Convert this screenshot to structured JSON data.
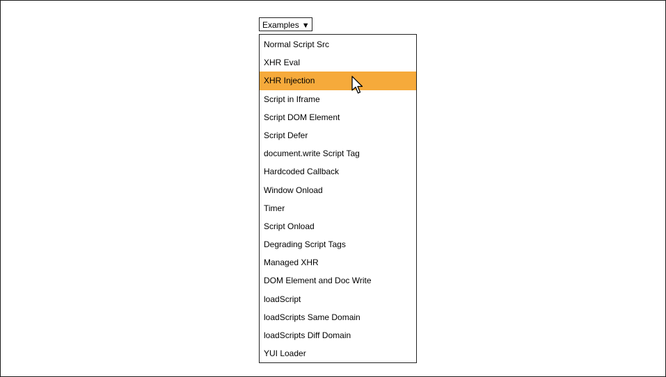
{
  "dropdown": {
    "label": "Examples",
    "caret": "▼"
  },
  "menu": {
    "items": [
      {
        "label": "Normal Script Src"
      },
      {
        "label": "XHR Eval"
      },
      {
        "label": "XHR Injection",
        "highlighted": true
      },
      {
        "label": "Script in Iframe"
      },
      {
        "label": "Script DOM Element"
      },
      {
        "label": "Script Defer"
      },
      {
        "label": "document.write Script Tag"
      },
      {
        "label": "Hardcoded Callback"
      },
      {
        "label": "Window Onload"
      },
      {
        "label": "Timer"
      },
      {
        "label": "Script Onload"
      },
      {
        "label": "Degrading Script Tags"
      },
      {
        "label": "Managed XHR"
      },
      {
        "label": "DOM Element and Doc Write"
      },
      {
        "label": "loadScript"
      },
      {
        "label": "loadScripts Same Domain"
      },
      {
        "label": "loadScripts Diff Domain"
      },
      {
        "label": "YUI Loader"
      }
    ]
  },
  "colors": {
    "highlight": "#f6aa3b",
    "border": "#222222"
  },
  "icons": {
    "cursor": "mouse-pointer-icon"
  }
}
